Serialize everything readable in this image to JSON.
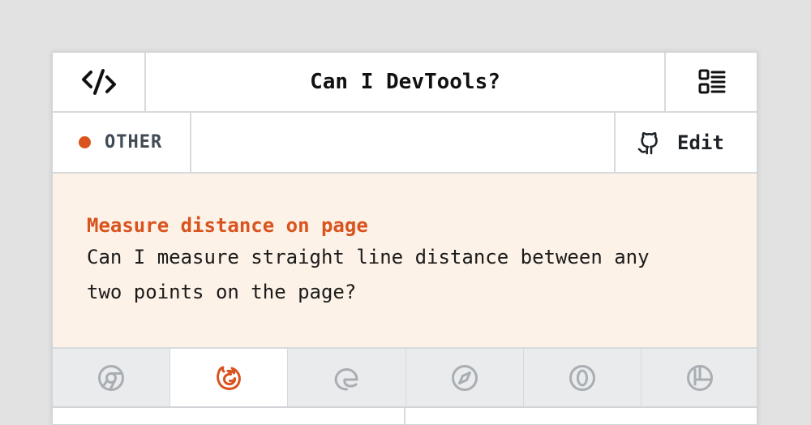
{
  "header": {
    "title": "Can I DevTools?",
    "logo_icon": "code-slash-icon",
    "menu_icon": "list-menu-icon"
  },
  "category": {
    "label": "OTHER",
    "dot_color": "#d9531e"
  },
  "edit": {
    "label": "Edit",
    "icon": "github-icon"
  },
  "feature": {
    "title": "Measure distance on page",
    "description_line1": "Can I measure straight line distance between any",
    "description_line2": "two points on the page?"
  },
  "browser_tabs": [
    {
      "name": "chrome-icon",
      "active": false
    },
    {
      "name": "firefox-icon",
      "active": true
    },
    {
      "name": "edge-icon",
      "active": false
    },
    {
      "name": "safari-icon",
      "active": false
    },
    {
      "name": "opera-icon",
      "active": false
    },
    {
      "name": "polypane-icon",
      "active": false
    }
  ],
  "colors": {
    "accent": "#d9531e",
    "feature_bg": "#fdf2e7",
    "inactive_icon": "#a9aeb3"
  }
}
